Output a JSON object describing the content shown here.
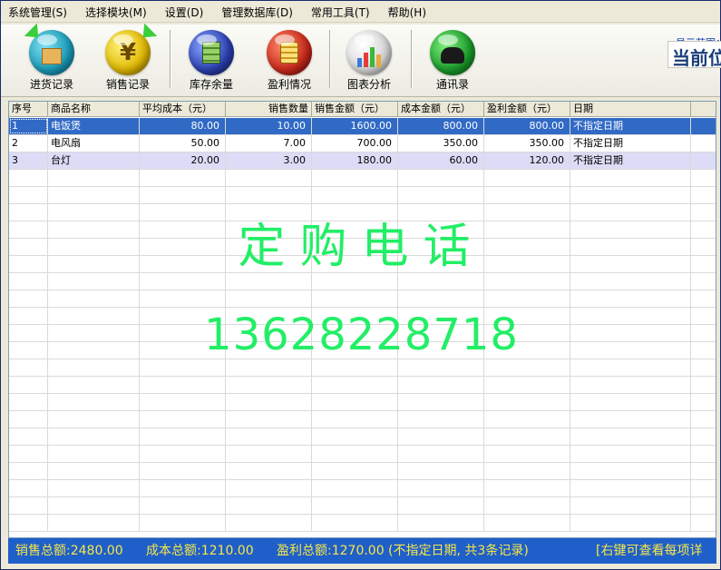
{
  "menu": [
    "系统管理(S)",
    "选择模块(M)",
    "设置(D)",
    "管理数据库(D)",
    "常用工具(T)",
    "帮助(H)"
  ],
  "toolbar": {
    "buttons": [
      {
        "label": "进货记录",
        "icon": "purchase-box-icon"
      },
      {
        "label": "销售记录",
        "icon": "yen-coin-icon"
      },
      {
        "label": "库存余量",
        "icon": "inventory-stack-icon"
      },
      {
        "label": "盈利情况",
        "icon": "coins-stack-icon"
      },
      {
        "label": "图表分析",
        "icon": "bar-chart-icon"
      },
      {
        "label": "通讯录",
        "icon": "telephone-icon"
      }
    ],
    "range_label": "显示范围：",
    "current_label": "当前位"
  },
  "table": {
    "headers": [
      "序号",
      "商品名称",
      "平均成本（元）",
      "销售数量",
      "销售金额（元）",
      "成本金额（元）",
      "盈利金额（元）",
      "日期"
    ],
    "rows": [
      [
        "1",
        "电饭煲",
        "80.00",
        "10.00",
        "1600.00",
        "800.00",
        "800.00",
        "不指定日期"
      ],
      [
        "2",
        "电风扇",
        "50.00",
        "7.00",
        "700.00",
        "350.00",
        "350.00",
        "不指定日期"
      ],
      [
        "3",
        "台灯",
        "20.00",
        "3.00",
        "180.00",
        "60.00",
        "120.00",
        "不指定日期"
      ]
    ]
  },
  "watermark": {
    "title": "定购电话",
    "phone": "13628228718"
  },
  "status": {
    "sales_total": "销售总额:2480.00",
    "cost_total": "成本总额:1210.00",
    "profit_total": "盈利总额:1270.00 (不指定日期, 共3条记录)",
    "hint": "[右键可查看每项详"
  },
  "colors": {
    "selection": "#316ac5",
    "alt_row": "#dcdcf6",
    "status_bg": "#1f5fc9",
    "status_text": "#f6e64a",
    "watermark": "#22ee66"
  }
}
